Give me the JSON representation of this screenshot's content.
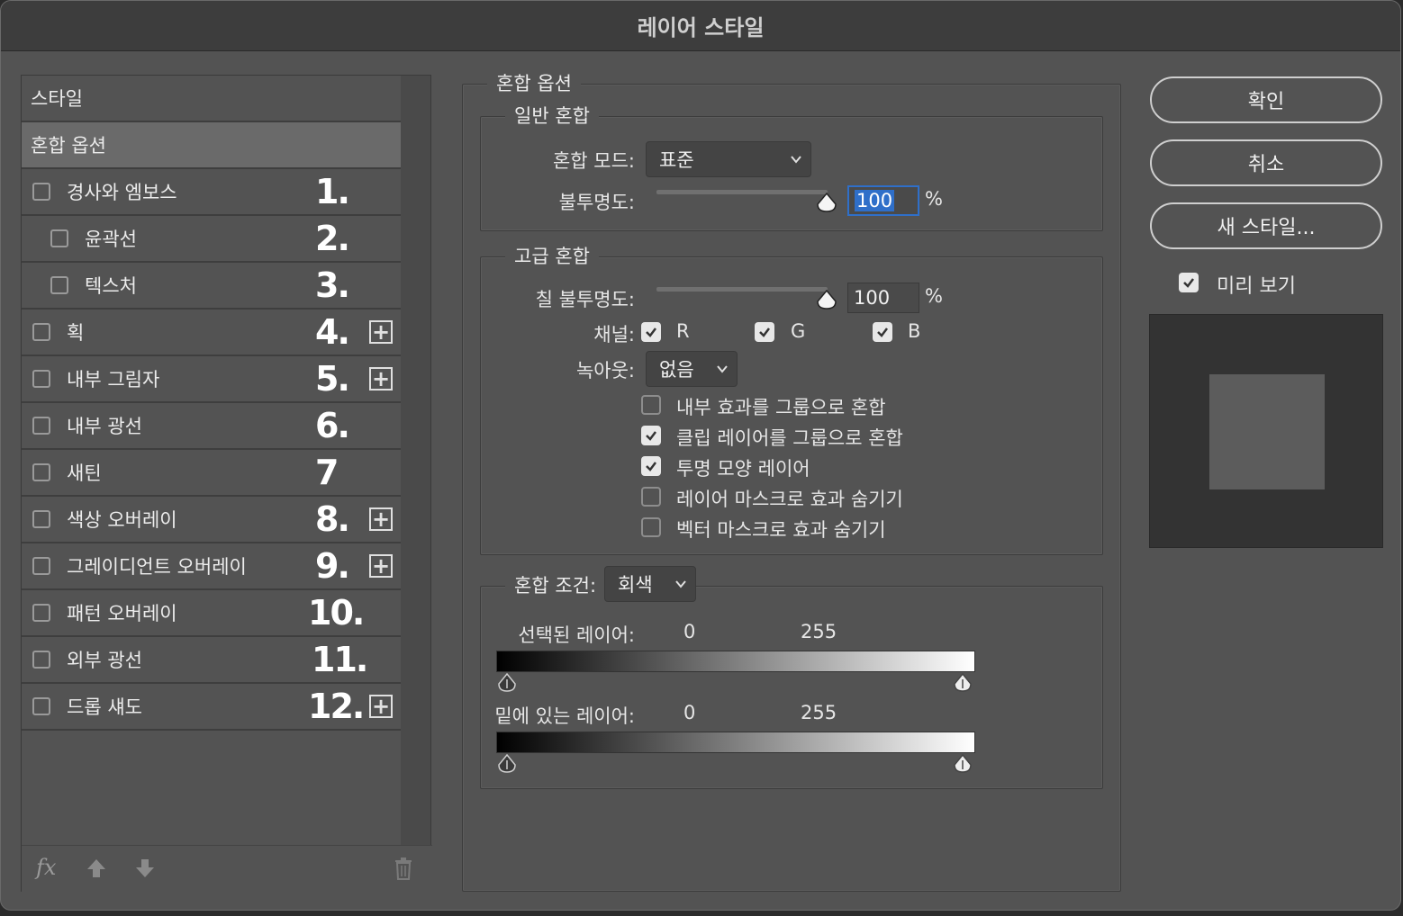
{
  "window": {
    "title": "레이어 스타일"
  },
  "styles_panel": {
    "header": "스타일",
    "items": [
      {
        "label": "혼합 옵션",
        "selected": true,
        "has_checkbox": false,
        "number": "",
        "has_plus": false
      },
      {
        "label": "경사와 엠보스",
        "checked": false,
        "number": "1.",
        "has_plus": false
      },
      {
        "label": "윤곽선",
        "checked": false,
        "number": "2.",
        "has_plus": false,
        "indent": true
      },
      {
        "label": "텍스처",
        "checked": false,
        "number": "3.",
        "has_plus": false,
        "indent": true
      },
      {
        "label": "획",
        "checked": false,
        "number": "4.",
        "has_plus": true
      },
      {
        "label": "내부 그림자",
        "checked": false,
        "number": "5.",
        "has_plus": true
      },
      {
        "label": "내부 광선",
        "checked": false,
        "number": "6.",
        "has_plus": false
      },
      {
        "label": "새틴",
        "checked": false,
        "number": "7",
        "has_plus": false
      },
      {
        "label": "색상 오버레이",
        "checked": false,
        "number": "8.",
        "has_plus": true
      },
      {
        "label": "그레이디언트 오버레이",
        "checked": false,
        "number": "9.",
        "has_plus": true
      },
      {
        "label": "패턴 오버레이",
        "checked": false,
        "number": "10.",
        "has_plus": false
      },
      {
        "label": "외부 광선",
        "checked": false,
        "number": "11.",
        "has_plus": false
      },
      {
        "label": "드롭 섀도",
        "checked": false,
        "number": "12.",
        "has_plus": true
      }
    ],
    "bottom_icons": [
      "fx-icon",
      "arrow-up-icon",
      "arrow-down-icon",
      "trash-icon"
    ],
    "fx_label": "fx"
  },
  "blending": {
    "section_title": "혼합 옵션",
    "general": {
      "title": "일반 혼합",
      "blend_mode_label": "혼합 모드:",
      "blend_mode_value": "표준",
      "opacity_label": "불투명도:",
      "opacity_value": "100",
      "percent": "%"
    },
    "advanced": {
      "title": "고급 혼합",
      "fill_opacity_label": "칠 불투명도:",
      "fill_opacity_value": "100",
      "percent": "%",
      "channels_label": "채널:",
      "channels": [
        {
          "name": "R",
          "checked": true
        },
        {
          "name": "G",
          "checked": true
        },
        {
          "name": "B",
          "checked": true
        }
      ],
      "knockout_label": "녹아웃:",
      "knockout_value": "없음",
      "options": [
        {
          "label": "내부 효과를 그룹으로 혼합",
          "checked": false
        },
        {
          "label": "클립 레이어를 그룹으로 혼합",
          "checked": true
        },
        {
          "label": "투명 모양 레이어",
          "checked": true
        },
        {
          "label": "레이어 마스크로 효과 숨기기",
          "checked": false
        },
        {
          "label": "벡터 마스크로 효과 숨기기",
          "checked": false
        }
      ]
    },
    "blend_if": {
      "label": "혼합 조건:",
      "value": "회색",
      "this_layer_label": "선택된 레이어:",
      "this_layer_min": "0",
      "this_layer_max": "255",
      "underlying_label": "밑에 있는 레이어:",
      "underlying_min": "0",
      "underlying_max": "255"
    }
  },
  "buttons": {
    "ok": "확인",
    "cancel": "취소",
    "new_style": "새 스타일...",
    "preview_label": "미리 보기",
    "preview_checked": true
  },
  "colors": {
    "dialog_bg": "#535353",
    "selected_row": "#6a6a6a",
    "focus_blue": "#2f6fc9"
  }
}
